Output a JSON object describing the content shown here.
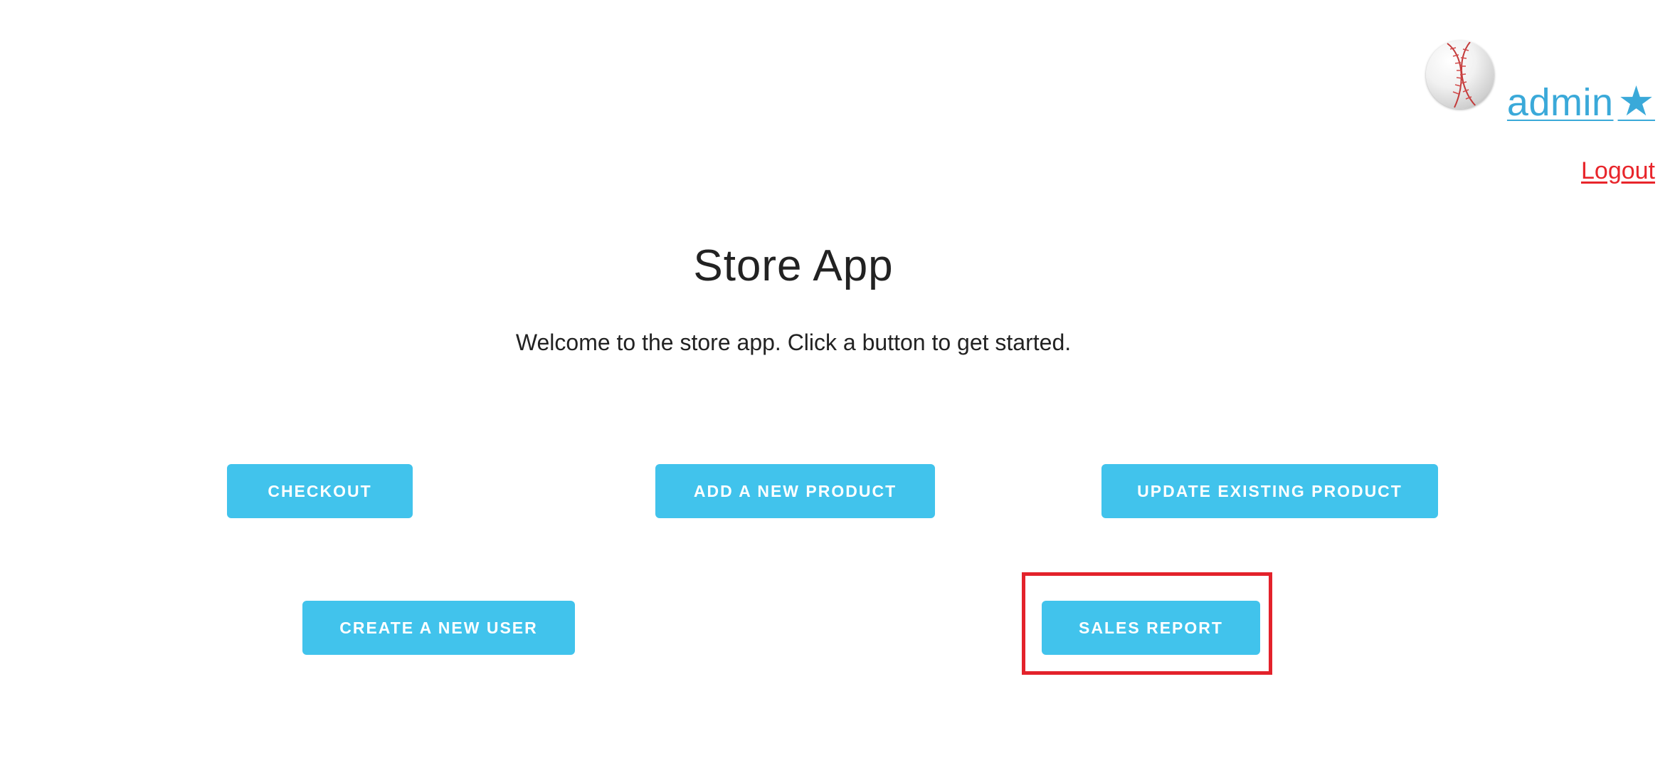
{
  "header": {
    "username": "admin",
    "admin_star_icon": "star-icon",
    "star_glyph": "★",
    "logout_label": "Logout",
    "avatar_icon": "baseball-avatar"
  },
  "main": {
    "title": "Store App",
    "welcome": "Welcome to the store app. Click a button to get started."
  },
  "buttons": {
    "checkout": "CHECKOUT",
    "add_product": "ADD A NEW PRODUCT",
    "update_product": "UPDATE EXISTING PRODUCT",
    "create_user": "CREATE A NEW USER",
    "sales_report": "SALES REPORT"
  },
  "colors": {
    "button_bg": "#41c3ec",
    "link_blue": "#3aa9d9",
    "logout_red": "#e8252b",
    "highlight_red": "#e3222b"
  }
}
